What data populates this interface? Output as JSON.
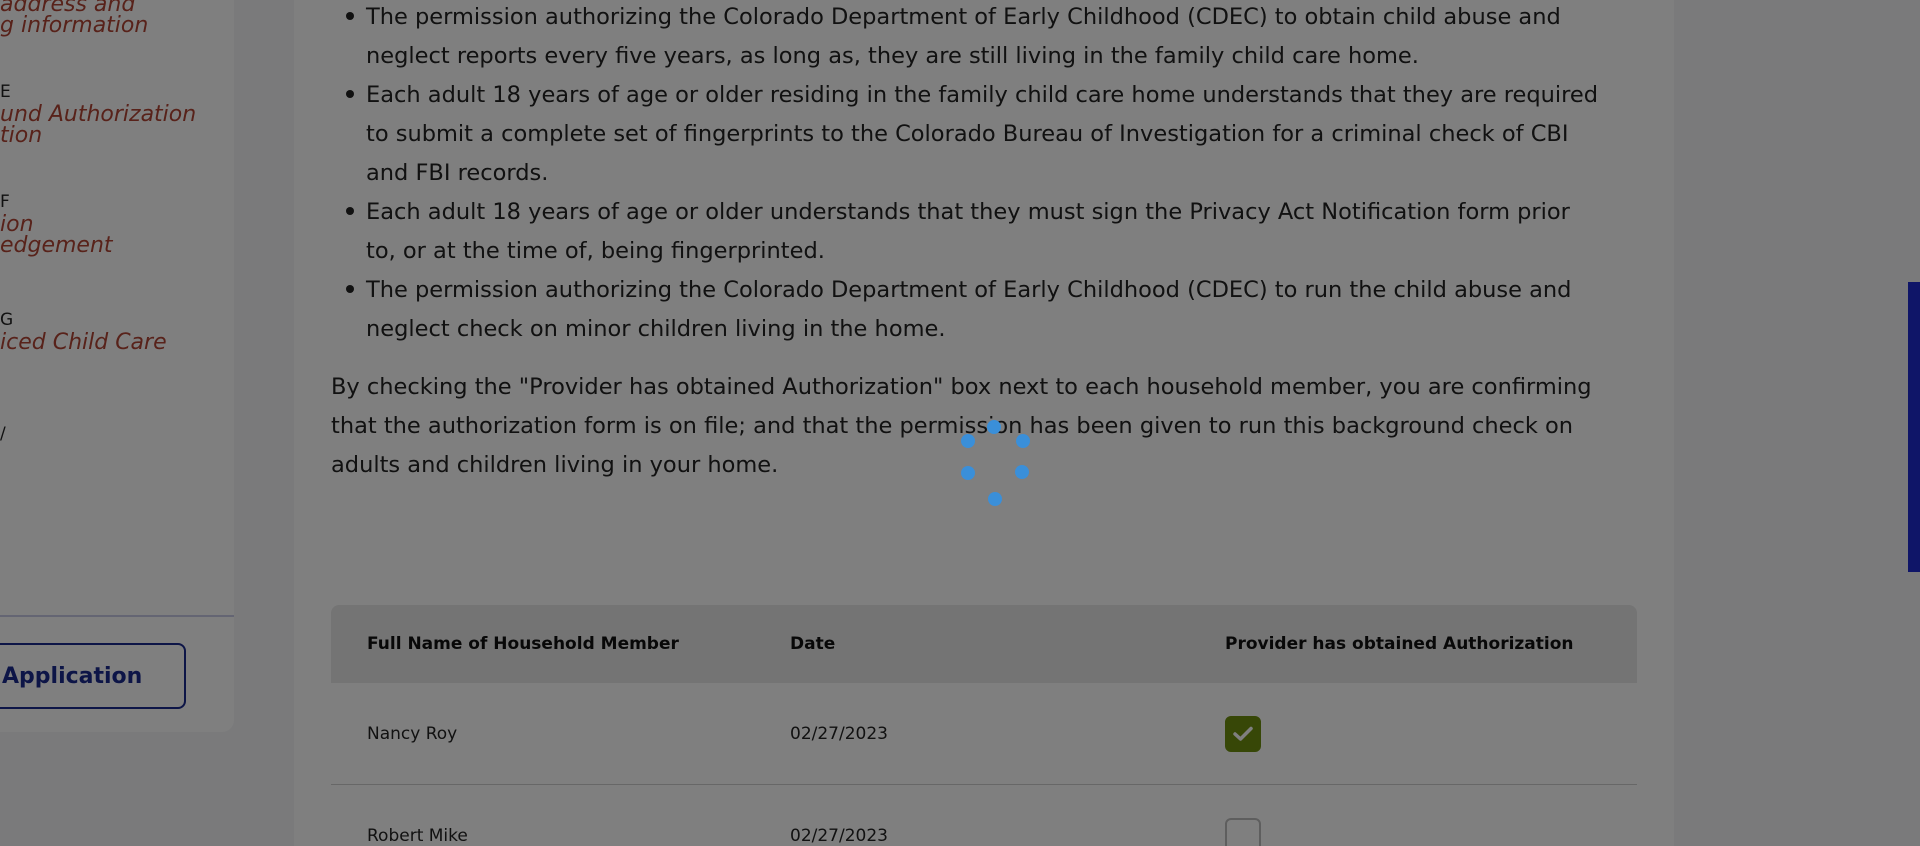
{
  "sidebar": {
    "steps": [
      {
        "letter": "",
        "title": "address and\ng information"
      },
      {
        "letter": "E",
        "title": "und Authorization\ntion"
      },
      {
        "letter": "F",
        "title": "ion\nedgement"
      },
      {
        "letter": "G",
        "title": "iced Child Care"
      },
      {
        "letter": "/",
        "title": ""
      }
    ],
    "application_button": "Application"
  },
  "bullets": [
    "The permission authorizing the Colorado Department of Early Childhood (CDEC) to obtain child abuse and neglect reports every five years, as long as, they are still living in the family child care home.",
    "Each adult 18 years of age or older residing in the family child care home understands that they are required to submit a complete set of fingerprints to the Colorado Bureau of Investigation for a criminal check of CBI and FBI records.",
    "Each adult 18 years of age or older understands that they must sign the Privacy Act Notification form prior to, or at the time of, being fingerprinted.",
    "The permission authorizing the Colorado Department of Early Childhood (CDEC) to run the child abuse and neglect check on minor children living in the home."
  ],
  "paragraph": "By checking the \"Provider has obtained Authorization\" box next to each household member, you are confirming that the authorization form is on file; and that the permission has been given to run this background check on adults and children living in your home.",
  "table": {
    "headers": [
      "Full Name of Household Member",
      "Date",
      "Provider has obtained Authorization"
    ],
    "rows": [
      {
        "name": "Nancy Roy",
        "date": "02/27/2023",
        "authorized": true
      },
      {
        "name": "Robert Mike",
        "date": "02/27/2023",
        "authorized": false
      }
    ]
  },
  "colors": {
    "accent": "#1b2a8e",
    "step_title": "#b04434",
    "checkbox_checked": "#6e8f0e",
    "spinner": "#3a8fd9"
  },
  "loading": true
}
